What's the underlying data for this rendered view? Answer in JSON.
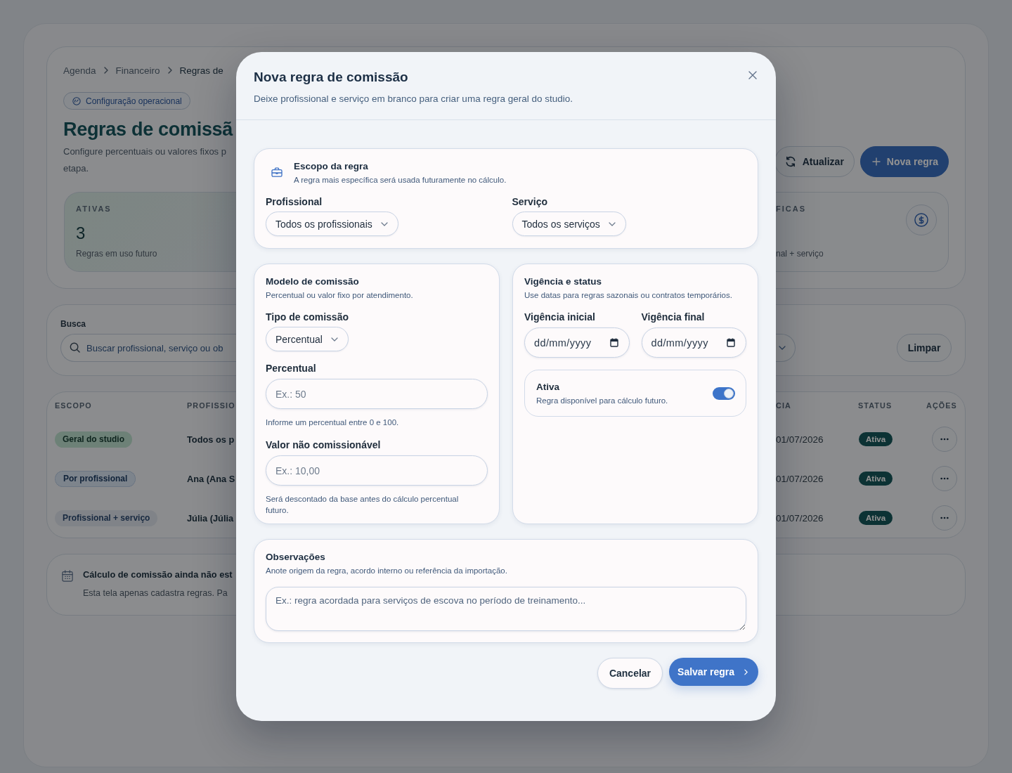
{
  "background_page": {
    "breadcrumb": [
      "Agenda",
      "Financeiro",
      "Regras de"
    ],
    "badge": "Configuração operacional",
    "title": "Regras de comissã",
    "subtitle_lines": [
      "Configure percentuais ou valores fixos p",
      "etapa."
    ],
    "actions": [
      {
        "kind": "secondary",
        "label": "Atualizar"
      },
      {
        "kind": "primary",
        "label": "Nova regra"
      }
    ],
    "stats": [
      {
        "kind": "count",
        "label": "ATIVAS",
        "value": "3",
        "caption": "Regras em uso futuro"
      },
      {
        "kind": "amount",
        "label": "FICAS",
        "caption": "nal + serviço"
      }
    ],
    "search": {
      "label": "Busca",
      "placeholder": "Buscar profissional, serviço ou ob",
      "clear_button": "Limpar"
    },
    "table": {
      "columns": [
        "ESCOPO",
        "PROFISSIO",
        "CIA",
        "STATUS",
        "AÇÕES"
      ],
      "rows": [
        {
          "scope": {
            "kind": "geral",
            "label": "Geral do studio"
          },
          "professional": "Todos os p",
          "period": "01/07/2026",
          "status": "Ativa"
        },
        {
          "scope": {
            "kind": "profissional",
            "label": "Por profissional"
          },
          "professional": "Ana (Ana S",
          "period": "01/07/2026",
          "status": "Ativa"
        },
        {
          "scope": {
            "kind": "combinado",
            "label": "Profissional + serviço"
          },
          "professional": "Júlia (Júlia",
          "period": "01/07/2026",
          "status": "Ativa"
        }
      ]
    },
    "notice": {
      "title": "Cálculo de comissão ainda não est",
      "text": "Esta tela apenas cadastra regras. Pa"
    }
  },
  "modal": {
    "title": "Nova regra de comissão",
    "subtitle": "Deixe profissional e serviço em branco para criar uma regra geral do studio.",
    "scope_section": {
      "title": "Escopo da regra",
      "description": "A regra mais específica será usada futuramente no cálculo.",
      "fields": [
        {
          "label": "Profissional",
          "value": "Todos os profissionais"
        },
        {
          "label": "Serviço",
          "value": "Todos os serviços"
        }
      ]
    },
    "model_section": {
      "title": "Modelo de comissão",
      "description": "Percentual ou valor fixo por atendimento.",
      "fields": [
        {
          "kind": "select",
          "label": "Tipo de comissão",
          "value": "Percentual"
        },
        {
          "kind": "input",
          "label": "Percentual",
          "placeholder": "Ex.: 50",
          "help": "Informe um percentual entre 0 e 100."
        },
        {
          "kind": "input",
          "label": "Valor não comissionável",
          "placeholder": "Ex.: 10,00",
          "help": "Será descontado da base antes do cálculo percentual futuro."
        }
      ]
    },
    "validity_section": {
      "title": "Vigência e status",
      "description": "Use datas para regras sazonais ou contratos temporários.",
      "dates": [
        {
          "label": "Vigência inicial",
          "placeholder": "dd/mm/yyyy"
        },
        {
          "label": "Vigência final",
          "placeholder": "dd/mm/yyyy"
        }
      ],
      "status_toggle": {
        "label": "Ativa",
        "description": "Regra disponível para cálculo futuro.",
        "on": true
      }
    },
    "notes_section": {
      "title": "Observações",
      "description": "Anote origem da regra, acordo interno ou referência da importação.",
      "placeholder": "Ex.: regra acordada para serviços de escova no período de treinamento..."
    },
    "buttons": [
      {
        "kind": "secondary",
        "label": "Cancelar"
      },
      {
        "kind": "primary",
        "label": "Salvar regra"
      }
    ]
  }
}
